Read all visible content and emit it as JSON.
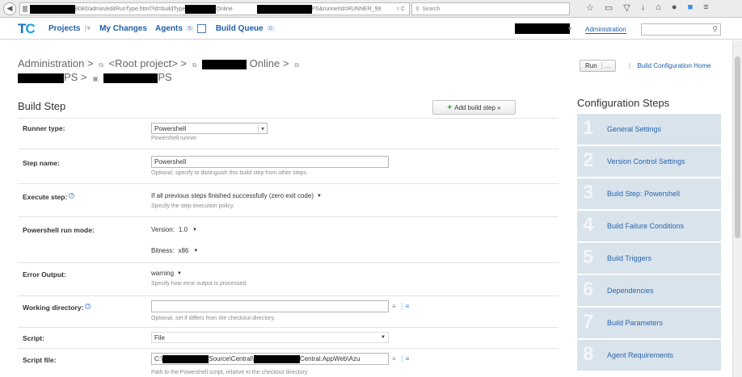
{
  "browser": {
    "url_prefix": "8080/admin/editRunType.html?id=buildType",
    "url_mid": "Online",
    "url_suffix": "PS&runnerId=RUNNER_99",
    "reload": "▿ C",
    "search_placeholder": "Search"
  },
  "header": {
    "logo_t": "T",
    "logo_c": "C",
    "nav": [
      {
        "label": "Projects"
      },
      {
        "label": "My Changes"
      },
      {
        "label": "Agents",
        "count": "5"
      },
      {
        "label": "Build Queue",
        "count": "0"
      }
    ],
    "admin_link": "Administration"
  },
  "breadcrumb": {
    "root": "Administration",
    "root_project": "<Root project>",
    "project_suffix": "Online",
    "line2_a": "PS",
    "line2_b": "PS",
    "sep": ">"
  },
  "actions": {
    "run_label": "Run",
    "run_dd": "...",
    "home_link": "Build Configuration Home"
  },
  "build_step": {
    "title": "Build Step",
    "add_button": "Add build step »",
    "runner_type_label": "Runner type:",
    "runner_type_value": "Powershell",
    "runner_type_hint": "Powershell runner",
    "step_name_label": "Step name:",
    "step_name_value": "Powershell",
    "step_name_hint": "Optional, specify to distinguish this build step from other steps.",
    "execute_label": "Execute step:",
    "execute_value": "If all previous steps finished successfully (zero exit code)",
    "execute_hint": "Specify the step execution policy.",
    "runmode_label": "Powershell run mode:",
    "version_label": "Version:",
    "version_value": "1.0",
    "bitness_label": "Bitness:",
    "bitness_value": "x86",
    "error_label": "Error Output:",
    "error_value": "warning",
    "error_hint": "Specify how error output is processed",
    "workdir_label": "Working directory:",
    "workdir_value": "",
    "workdir_hint": "Optional, set if differs from the checkout directory.",
    "script_label": "Script:",
    "script_value": "File",
    "scriptfile_label": "Script file:",
    "scriptfile_a": "C:\\",
    "scriptfile_b": "Source\\Central\\",
    "scriptfile_c": "Central.AppWeb\\Azu",
    "scriptfile_hint": "Path to the Powershell script, relative to the checkout directory"
  },
  "config_steps": {
    "title": "Configuration Steps",
    "items": [
      {
        "num": "1",
        "label": "General Settings"
      },
      {
        "num": "2",
        "label": "Version Control Settings"
      },
      {
        "num": "3",
        "label": "Build Step: Powershell"
      },
      {
        "num": "4",
        "label": "Build Failure Conditions"
      },
      {
        "num": "5",
        "label": "Build Triggers"
      },
      {
        "num": "6",
        "label": "Dependencies"
      },
      {
        "num": "7",
        "label": "Build Parameters"
      },
      {
        "num": "8",
        "label": "Agent Requirements"
      }
    ]
  }
}
